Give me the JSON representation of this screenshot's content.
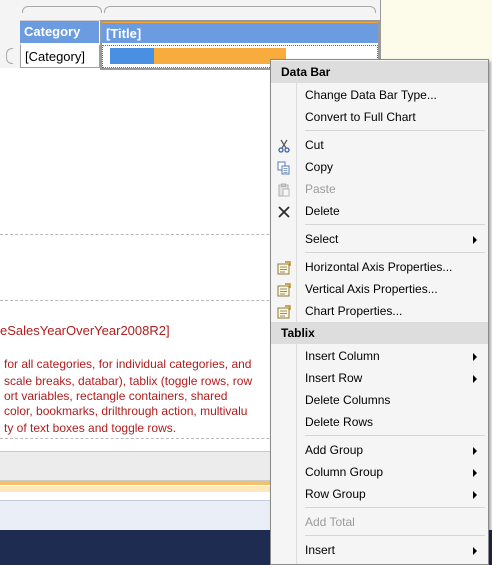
{
  "tablix": {
    "header_category": "Category",
    "header_title": "[Title]",
    "cell_category": "[Category]"
  },
  "dataset_text": "eSalesYearOverYear2008R2]",
  "description_lines": [
    " for all categories, for individual categories, and",
    "scale breaks, databar), tablix (toggle rows, row",
    "ort variables, rectangle containers, shared",
    " color, bookmarks, drilthrough action, multivalu",
    "ty of text boxes and toggle rows."
  ],
  "context_menu": {
    "section_databar": "Data Bar",
    "change_databar_type": "Change Data Bar Type...",
    "convert_full_chart": "Convert to Full Chart",
    "cut": "Cut",
    "copy": "Copy",
    "paste": "Paste",
    "delete": "Delete",
    "select": "Select",
    "horizontal_axis": "Horizontal Axis Properties...",
    "vertical_axis": "Vertical Axis Properties...",
    "chart_properties": "Chart Properties...",
    "section_tablix": "Tablix",
    "insert_column": "Insert Column",
    "insert_row": "Insert Row",
    "delete_columns": "Delete Columns",
    "delete_rows": "Delete Rows",
    "add_group": "Add Group",
    "column_group": "Column Group",
    "row_group": "Row Group",
    "add_total": "Add Total",
    "insert": "Insert"
  },
  "colors": {
    "header_blue": "#6b9be0",
    "databar_blue": "#4a90e2",
    "databar_orange": "#f7ac3d",
    "description_red": "#b11d1d"
  },
  "icons": {
    "cut": "scissors-icon",
    "copy": "copy-icon",
    "paste": "paste-icon",
    "delete": "delete-x-icon",
    "axis_properties": "properties-icon"
  }
}
